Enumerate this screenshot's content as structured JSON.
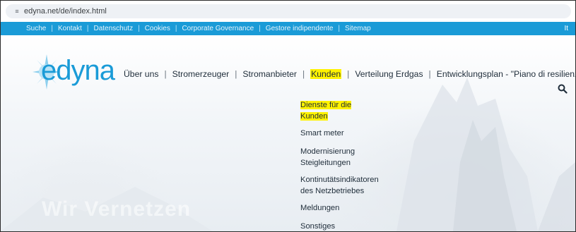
{
  "browser": {
    "url": "edyna.net/de/index.html",
    "site_icon": "site-info-icon"
  },
  "topbar": {
    "items": [
      "Suche",
      "Kontakt",
      "Datenschutz",
      "Cookies",
      "Corporate Governance",
      "Gestore indipendente",
      "Sitemap"
    ],
    "separator": "|",
    "language": "It",
    "color": "#1a9bd7"
  },
  "header": {
    "logo_text": "edyna",
    "brand_color": "#1a9bd7",
    "nav": [
      "Über uns",
      "Stromerzeuger",
      "Stromanbieter",
      "Kunden",
      "Verteilung Erdgas",
      "Entwicklungsplan - \"Piano di resilienza\""
    ],
    "separator": "|",
    "active": "Kunden",
    "highlight_color": "#fff200",
    "search_icon": "search-icon"
  },
  "dropdown": {
    "items": [
      {
        "lines": [
          "Dienste für die",
          "Kunden"
        ],
        "highlighted": true
      },
      {
        "lines": [
          "Smart meter"
        ],
        "highlighted": false
      },
      {
        "lines": [
          "Modernisierung",
          "Steigleitungen"
        ],
        "highlighted": false
      },
      {
        "lines": [
          "Kontinutätsindikatoren",
          "des Netzbetriebes"
        ],
        "highlighted": false
      },
      {
        "lines": [
          "Meldungen"
        ],
        "highlighted": false
      },
      {
        "lines": [
          "Sonstiges"
        ],
        "highlighted": false
      }
    ]
  },
  "hero": {
    "faded_heading": "Wir Vernetzen"
  }
}
